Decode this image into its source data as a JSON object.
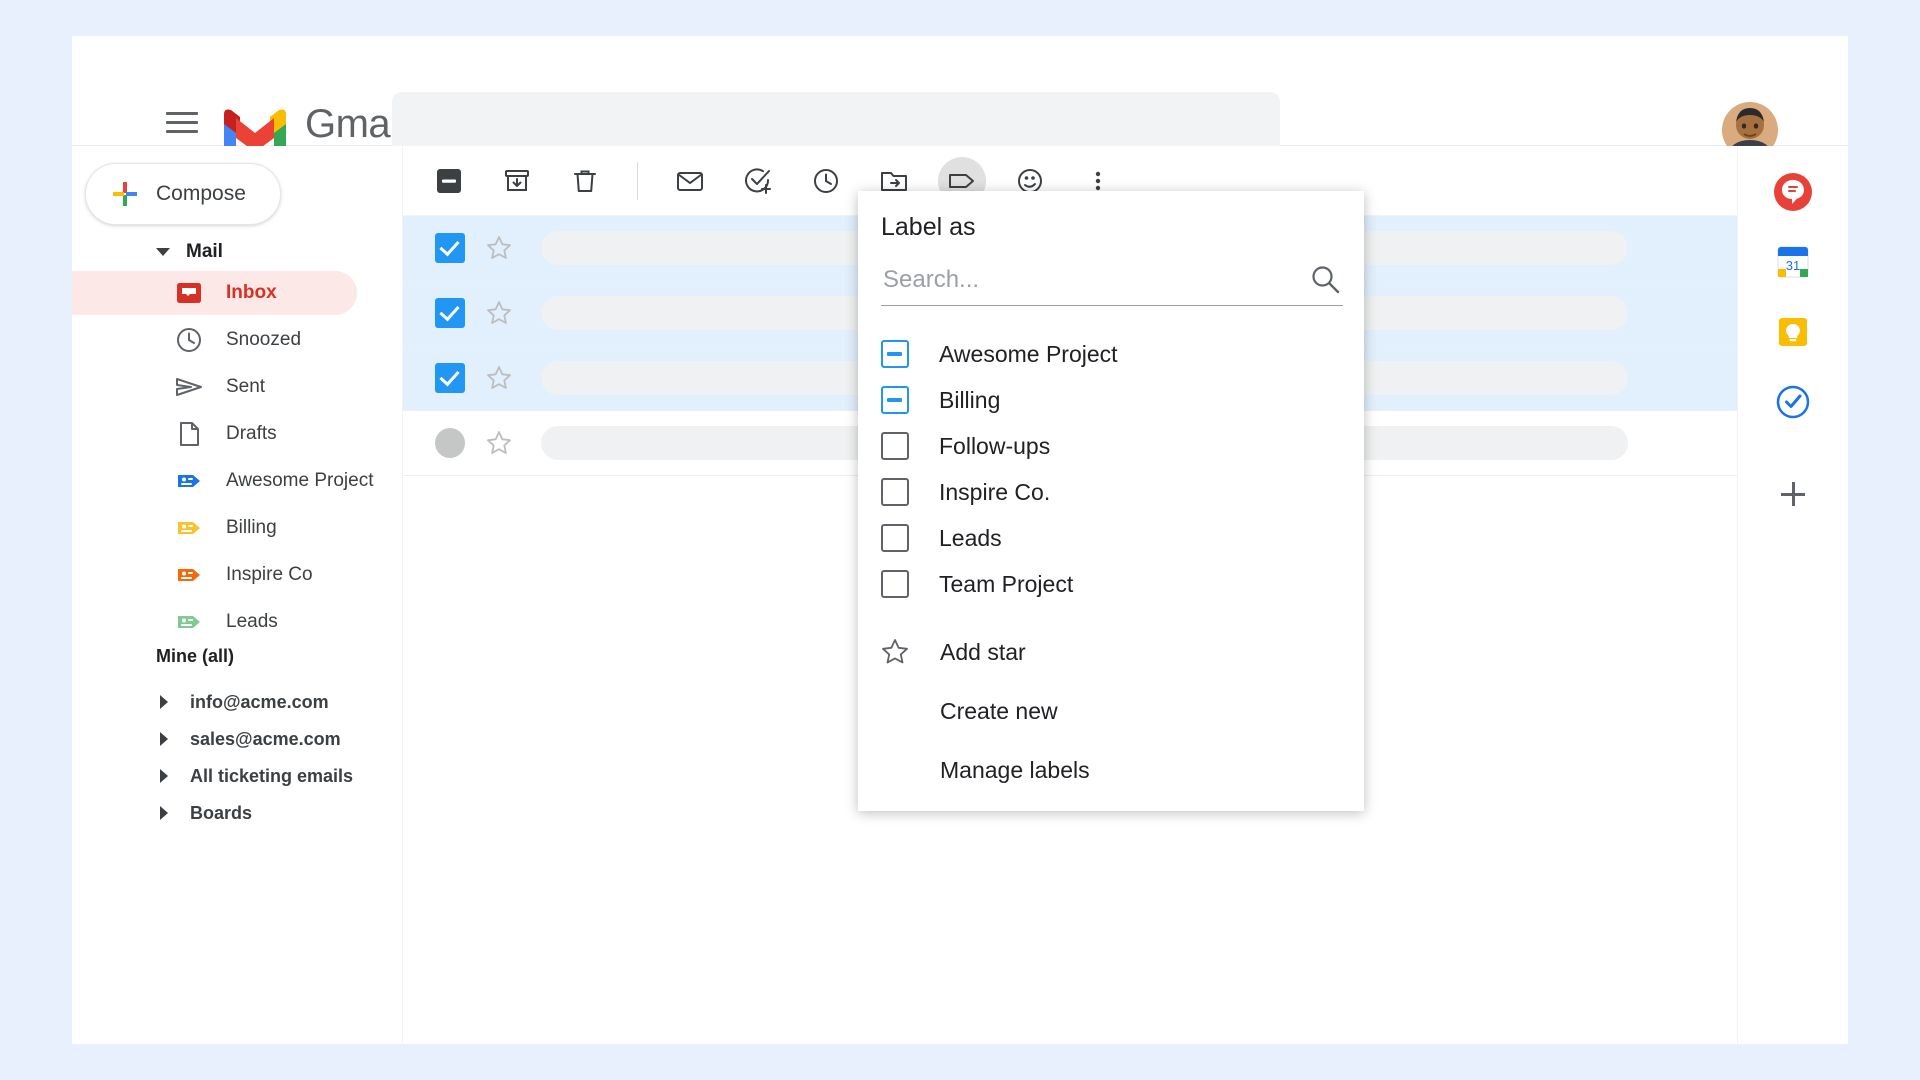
{
  "header": {
    "menu_icon": "hamburger-menu-icon",
    "logo_icon": "gmail-logo-icon",
    "wordmark": "Gmail",
    "search_value": "",
    "search_placeholder": "",
    "avatar_icon": "user-avatar"
  },
  "sidebar": {
    "compose": {
      "label": "Compose",
      "icon": "plus-icon"
    },
    "mail_section": {
      "label": "Mail",
      "icon": "caret-down-icon"
    },
    "nav_items": [
      {
        "label": "Inbox",
        "icon": "inbox-icon",
        "color": "#d93025",
        "active": true
      },
      {
        "label": "Snoozed",
        "icon": "clock-icon",
        "color": "#5f6368",
        "active": false
      },
      {
        "label": "Sent",
        "icon": "send-icon",
        "color": "#5f6368",
        "active": false
      },
      {
        "label": "Drafts",
        "icon": "document-icon",
        "color": "#5f6368",
        "active": false
      },
      {
        "label": "Awesome Project",
        "icon": "label-tag-icon",
        "color": "#1a73e8",
        "active": false
      },
      {
        "label": "Billing",
        "icon": "label-tag-icon",
        "color": "#f9c22e",
        "active": false
      },
      {
        "label": "Inspire Co",
        "icon": "label-tag-icon",
        "color": "#f46a0a",
        "active": false
      },
      {
        "label": "Leads",
        "icon": "label-tag-icon",
        "color": "#81c995",
        "active": false
      }
    ],
    "group_title": "Mine (all)",
    "tree_items": [
      {
        "label": "info@acme.com",
        "icon": "caret-right-icon"
      },
      {
        "label": "sales@acme.com",
        "icon": "caret-right-icon"
      },
      {
        "label": "All ticketing emails",
        "icon": "caret-right-icon"
      },
      {
        "label": "Boards",
        "icon": "caret-right-icon"
      }
    ]
  },
  "toolbar": {
    "buttons": [
      {
        "name": "select-all-checkbox",
        "icon": "indeterminate-checkbox-icon",
        "active": false
      },
      {
        "name": "archive-button",
        "icon": "archive-icon",
        "active": false
      },
      {
        "name": "delete-button",
        "icon": "trash-icon",
        "active": false
      },
      {
        "name": "mark-unread-button",
        "icon": "envelope-icon",
        "active": false
      },
      {
        "name": "add-to-tasks-button",
        "icon": "check-circle-plus-icon",
        "active": false
      },
      {
        "name": "snooze-button",
        "icon": "clock-icon",
        "active": false
      },
      {
        "name": "move-to-button",
        "icon": "move-to-folder-icon",
        "active": false
      },
      {
        "name": "label-as-button",
        "icon": "label-tag-icon",
        "active": true
      },
      {
        "name": "assign-button",
        "icon": "person-tag-icon",
        "active": false
      },
      {
        "name": "more-options-button",
        "icon": "more-vertical-icon",
        "active": false
      }
    ]
  },
  "mail_list": {
    "rows": [
      {
        "selected": true,
        "checkbox": "checked",
        "star": "star-outline-icon",
        "content": ""
      },
      {
        "selected": true,
        "checkbox": "checked",
        "star": "star-outline-icon",
        "content": ""
      },
      {
        "selected": true,
        "checkbox": "checked",
        "star": "star-outline-icon",
        "content": ""
      },
      {
        "selected": false,
        "checkbox": "unchecked",
        "star": "star-outline-icon",
        "content": ""
      }
    ]
  },
  "label_dropdown": {
    "title": "Label as",
    "search_value": "",
    "search_placeholder": "Search...",
    "search_icon": "search-icon",
    "options": [
      {
        "label": "Awesome Project",
        "state": "indeterminate"
      },
      {
        "label": "Billing",
        "state": "indeterminate"
      },
      {
        "label": "Follow-ups",
        "state": "unchecked"
      },
      {
        "label": "Inspire Co.",
        "state": "unchecked"
      },
      {
        "label": "Leads",
        "state": "unchecked"
      },
      {
        "label": "Team Project",
        "state": "unchecked"
      }
    ],
    "actions": [
      {
        "label": "Add star",
        "icon": "star-outline-icon"
      },
      {
        "label": "Create new",
        "icon": ""
      },
      {
        "label": "Manage labels",
        "icon": ""
      }
    ]
  },
  "right_rail": {
    "apps": [
      {
        "name": "chat-app",
        "icon": "chat-icon",
        "color": "#e8413a"
      },
      {
        "name": "calendar-app",
        "icon": "calendar-icon",
        "color": "#1a73e8"
      },
      {
        "name": "keep-app",
        "icon": "keep-bulb-icon",
        "color": "#fbbc04"
      },
      {
        "name": "tasks-app",
        "icon": "tasks-icon",
        "color": "#1a73e8"
      }
    ],
    "add_button": {
      "name": "add-app-button",
      "icon": "plus-icon"
    }
  },
  "colors": {
    "accent_blue": "#2196f3",
    "inbox_red": "#d93025",
    "selected_row_bg": "#e2f0fd",
    "page_bg": "#e8f0fe"
  }
}
